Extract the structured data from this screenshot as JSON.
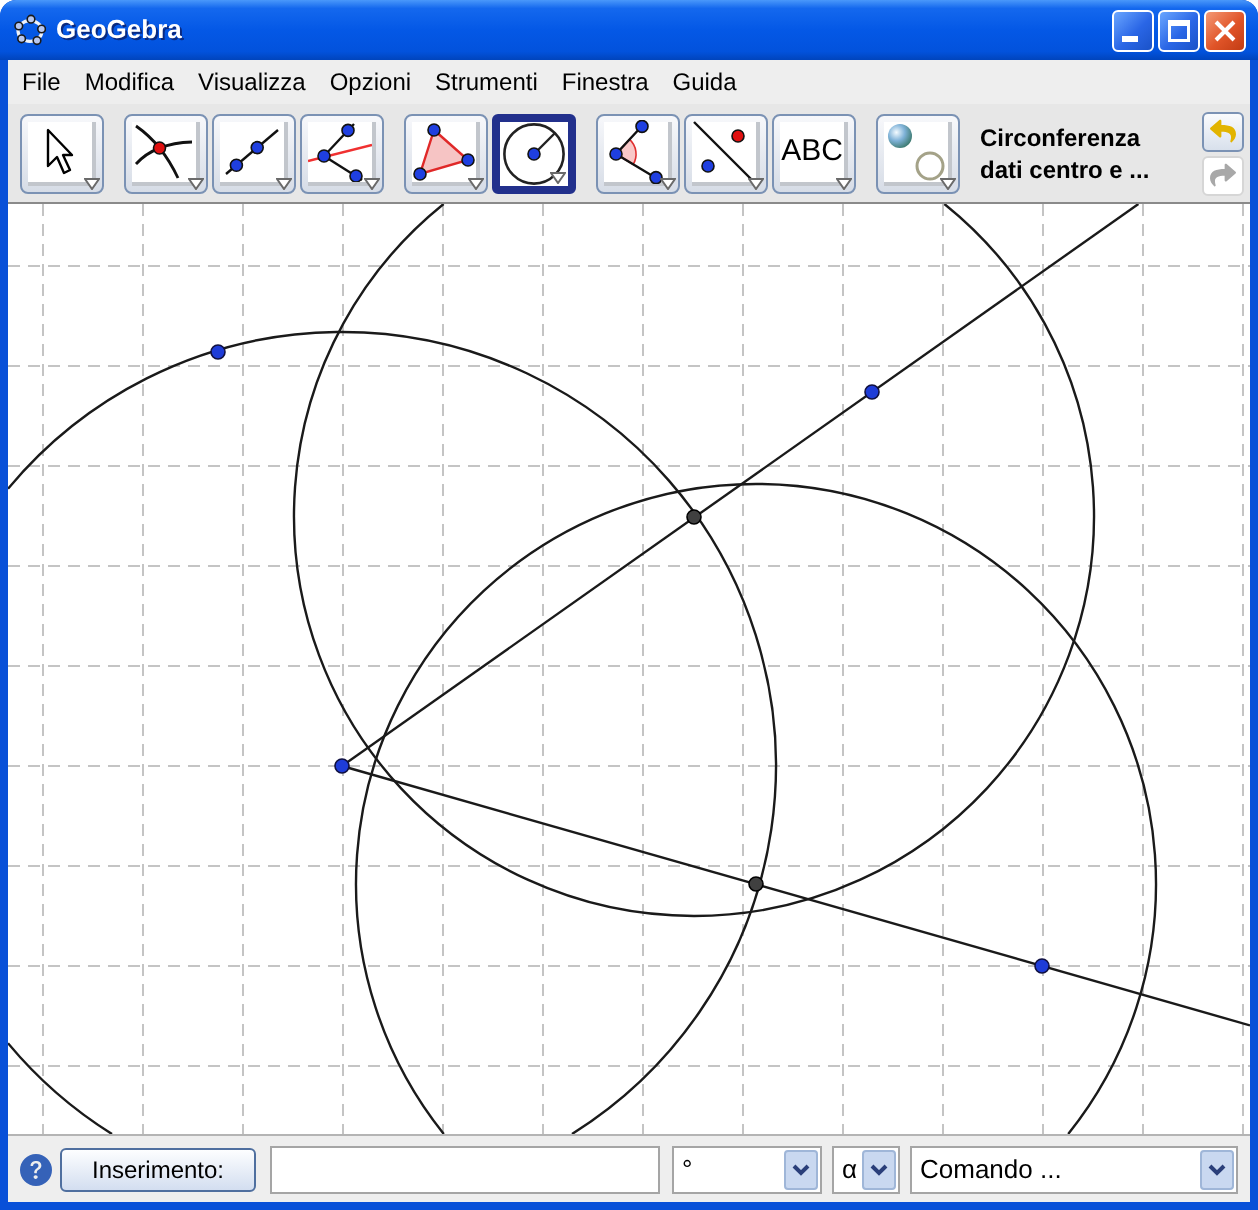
{
  "window": {
    "title": "GeoGebra"
  },
  "menu": [
    "File",
    "Modifica",
    "Visualizza",
    "Opzioni",
    "Strumenti",
    "Finestra",
    "Guida"
  ],
  "toolbar": {
    "groups": [
      [
        {
          "kind": "move",
          "selected": false
        }
      ],
      [
        {
          "kind": "intersect",
          "selected": false
        },
        {
          "kind": "segment",
          "selected": false
        },
        {
          "kind": "bisector",
          "selected": false
        }
      ],
      [
        {
          "kind": "polygon",
          "selected": false
        },
        {
          "kind": "circle",
          "selected": true
        }
      ],
      [
        {
          "kind": "angle",
          "selected": false
        },
        {
          "kind": "reflect",
          "selected": false
        },
        {
          "kind": "text",
          "label": "ABC",
          "selected": false
        }
      ],
      [
        {
          "kind": "show_hide",
          "selected": false
        }
      ]
    ],
    "tool_name": [
      "Circonferenza",
      "dati centro e ..."
    ],
    "undo": {
      "disabled": false
    },
    "redo": {
      "disabled": true
    }
  },
  "input_bar": {
    "button": "Inserimento:",
    "dropdowns": [
      {
        "kind": "symbol",
        "value": "°"
      },
      {
        "kind": "greek",
        "value": "α"
      },
      {
        "kind": "command",
        "value": "Comando ..."
      }
    ]
  }
}
